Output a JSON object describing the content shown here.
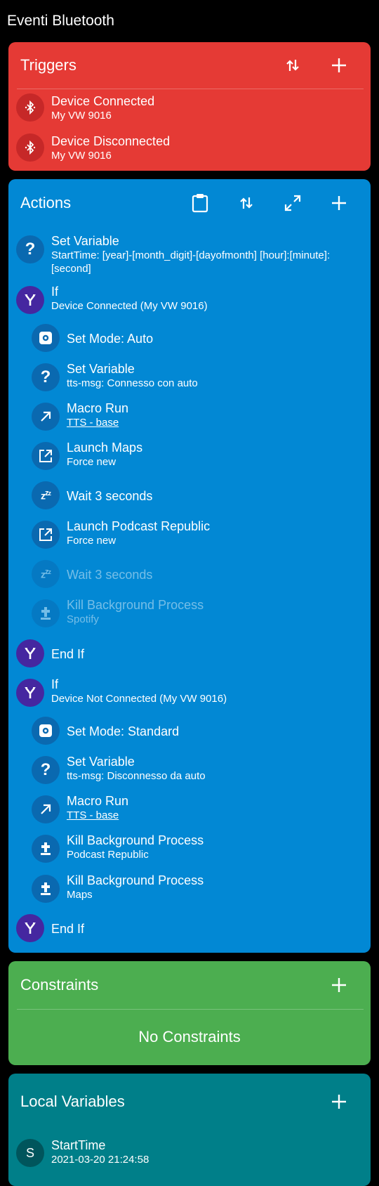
{
  "app": {
    "title": "Eventi Bluetooth"
  },
  "triggers": {
    "title": "Triggers",
    "items": [
      {
        "icon": "bluetooth-icon",
        "title": "Device Connected",
        "subtitle": "My VW 9016"
      },
      {
        "icon": "bluetooth-icon",
        "title": "Device Disconnected",
        "subtitle": "My VW 9016"
      }
    ]
  },
  "actions": {
    "title": "Actions",
    "items": [
      {
        "icon": "question-icon",
        "title": "Set Variable",
        "subtitle": "StartTime: [year]-[month_digit]-[dayofmonth] [hour]:[minute]:\n[second]"
      },
      {
        "icon": "if-branch-icon",
        "title": "If",
        "subtitle": "Device Connected (My VW 9016)"
      },
      {
        "icon": "settings-icon",
        "title": "Set Mode: Auto",
        "subtitle": ""
      },
      {
        "icon": "question-icon",
        "title": "Set Variable",
        "subtitle": "tts-msg: Connesso con auto"
      },
      {
        "icon": "arrow-out-icon",
        "title": "Macro Run",
        "subtitle": "TTS - base"
      },
      {
        "icon": "launch-icon",
        "title": "Launch Maps",
        "subtitle": "Force new"
      },
      {
        "icon": "sleep-zzz-icon",
        "title": "Wait 3 seconds",
        "subtitle": ""
      },
      {
        "icon": "launch-icon",
        "title": "Launch Podcast Republic",
        "subtitle": "Force new"
      },
      {
        "icon": "sleep-zzz-icon",
        "title": "Wait 3 seconds",
        "subtitle": ""
      },
      {
        "icon": "tombstone-icon",
        "title": "Kill Background Process",
        "subtitle": "Spotify"
      },
      {
        "icon": "if-branch-icon",
        "title": "End If",
        "subtitle": ""
      },
      {
        "icon": "if-branch-icon",
        "title": "If",
        "subtitle": "Device Not Connected (My VW 9016)"
      },
      {
        "icon": "settings-icon",
        "title": "Set Mode: Standard",
        "subtitle": ""
      },
      {
        "icon": "question-icon",
        "title": "Set Variable",
        "subtitle": "tts-msg: Disconnesso da auto"
      },
      {
        "icon": "arrow-out-icon",
        "title": "Macro Run",
        "subtitle": "TTS - base"
      },
      {
        "icon": "tombstone-icon",
        "title": "Kill Background Process",
        "subtitle": "Podcast Republic"
      },
      {
        "icon": "tombstone-icon",
        "title": "Kill Background Process",
        "subtitle": "Maps"
      },
      {
        "icon": "if-branch-icon",
        "title": "End If",
        "subtitle": ""
      }
    ]
  },
  "constraints": {
    "title": "Constraints",
    "empty_text": "No Constraints"
  },
  "local_variables": {
    "title": "Local Variables",
    "items": [
      {
        "avatar_letter": "S",
        "name": "StartTime",
        "value": "2021-03-20 21:24:58"
      }
    ]
  },
  "colors": {
    "triggers": "#e53a35",
    "actions": "#0288d4",
    "constraints": "#4cae50",
    "local_variables": "#007f89",
    "action_icon": "#0a69b0",
    "if_icon": "#4527a0"
  }
}
